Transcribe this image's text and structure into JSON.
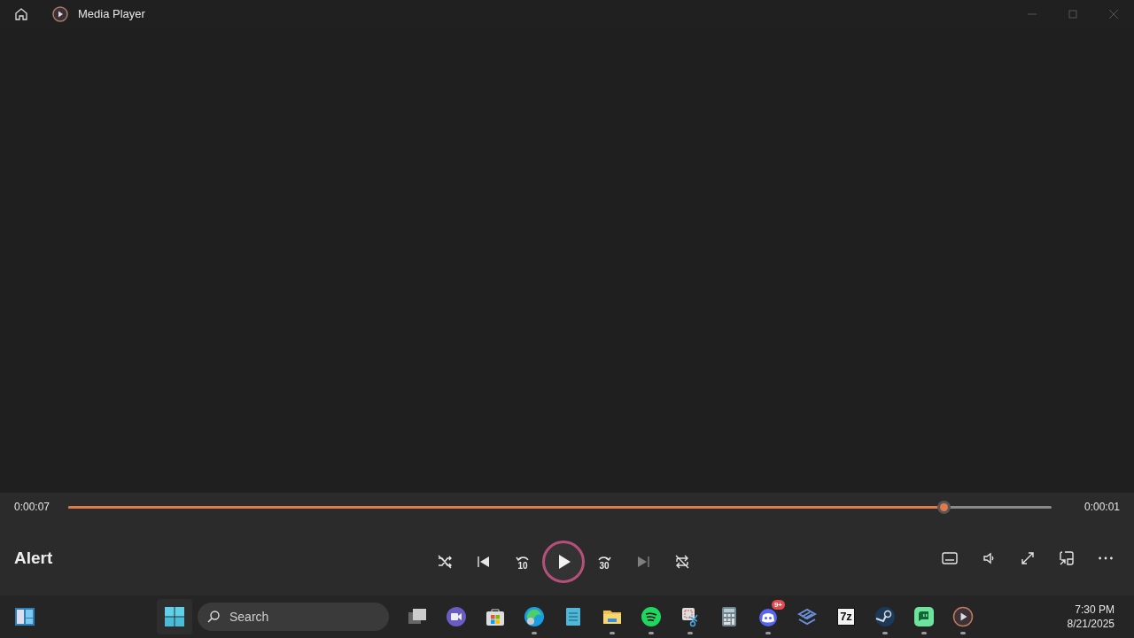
{
  "window": {
    "title": "Media Player"
  },
  "player": {
    "elapsed": "0:00:07",
    "remaining": "0:00:01",
    "level": 0.89,
    "track_title": "Alert"
  },
  "controls": [
    {
      "kind": "shuffle",
      "disabled": false
    },
    {
      "kind": "previous",
      "disabled": false
    },
    {
      "kind": "back10",
      "disabled": false,
      "label": "10"
    },
    {
      "kind": "play",
      "disabled": false
    },
    {
      "kind": "forward30",
      "disabled": false,
      "label": "30"
    },
    {
      "kind": "next",
      "disabled": true
    },
    {
      "kind": "repeat",
      "disabled": false
    }
  ],
  "tools": [
    {
      "kind": "captions"
    },
    {
      "kind": "volume"
    },
    {
      "kind": "fullscreen"
    },
    {
      "kind": "miniplayer"
    },
    {
      "kind": "more"
    }
  ],
  "taskbar": {
    "search_placeholder": "Search",
    "time": "7:30 PM",
    "date": "8/21/2025",
    "apps": [
      {
        "kind": "taskview",
        "running": false
      },
      {
        "kind": "meet",
        "running": false
      },
      {
        "kind": "store",
        "running": false
      },
      {
        "kind": "edge",
        "running": true
      },
      {
        "kind": "notepad",
        "running": false
      },
      {
        "kind": "folder",
        "running": true
      },
      {
        "kind": "spotify",
        "running": true
      },
      {
        "kind": "snip",
        "running": true
      },
      {
        "kind": "calculator",
        "running": false
      },
      {
        "kind": "discord",
        "running": true,
        "badge": "9+"
      },
      {
        "kind": "blueapp",
        "running": false
      },
      {
        "kind": "zip",
        "running": false,
        "label": "7z"
      },
      {
        "kind": "steam",
        "running": true
      },
      {
        "kind": "greenapp",
        "running": true
      },
      {
        "kind": "mediaplayer",
        "running": true
      }
    ]
  }
}
